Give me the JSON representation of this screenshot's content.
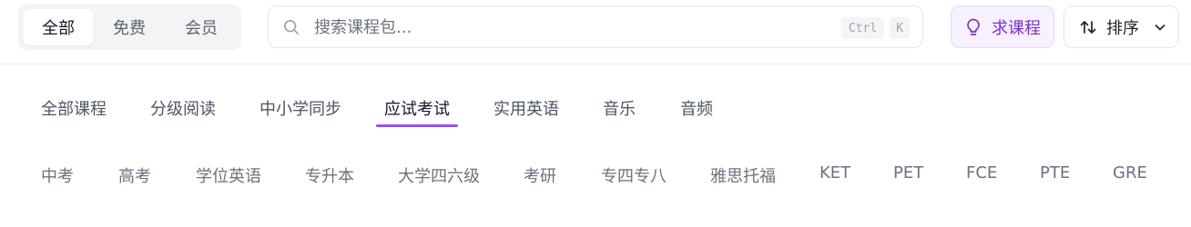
{
  "filter_tabs": {
    "items": [
      {
        "label": "全部",
        "active": true
      },
      {
        "label": "免费",
        "active": false
      },
      {
        "label": "会员",
        "active": false
      }
    ]
  },
  "search": {
    "placeholder": "搜索课程包...",
    "value": "",
    "icon": "search-icon",
    "shortcut_keys": [
      "Ctrl",
      "K"
    ]
  },
  "request_button": {
    "label": "求课程",
    "icon": "lightbulb-icon",
    "accent": "#7c2fc9"
  },
  "sort_button": {
    "label": "排序",
    "icon": "sort-arrows-icon",
    "chevron": "chevron-down-icon"
  },
  "categories": {
    "active_index": 3,
    "accent": "#9b4ff0",
    "items": [
      "全部课程",
      "分级阅读",
      "中小学同步",
      "应试考试",
      "实用英语",
      "音乐",
      "音频"
    ]
  },
  "subcategories": {
    "items": [
      "中考",
      "高考",
      "学位英语",
      "专升本",
      "大学四六级",
      "考研",
      "专四专八",
      "雅思托福",
      "KET",
      "PET",
      "FCE",
      "PTE",
      "GRE"
    ]
  }
}
